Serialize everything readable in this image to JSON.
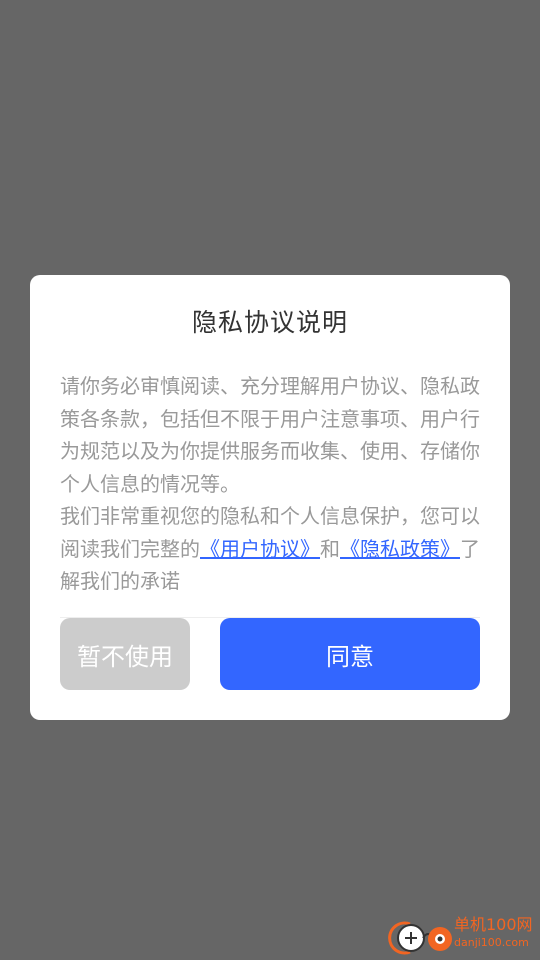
{
  "dialog": {
    "title": "隐私协议说明",
    "paragraph1": "请你务必审慎阅读、充分理解用户协议、隐私政策各条款，包括但不限于用户注意事项、用户行为规范以及为你提供服务而收集、使用、存储你个人信息的情况等。",
    "paragraph2_prefix": "我们非常重视您的隐私和个人信息保护，您可以阅读我们完整的",
    "user_agreement_link": "《用户协议》",
    "and_text": "和",
    "privacy_policy_link": "《隐私政策》",
    "paragraph2_suffix": "了解我们的承诺",
    "decline_label": "暂不使用",
    "agree_label": "同意"
  },
  "watermark": {
    "name": "单机100网",
    "url": "danji100.com"
  },
  "colors": {
    "overlay": "#666666",
    "dialog_bg": "#ffffff",
    "title": "#333333",
    "body_text": "#999999",
    "link": "#3366ff",
    "decline_bg": "#cccccc",
    "agree_bg": "#3366ff",
    "watermark": "#f26522"
  }
}
